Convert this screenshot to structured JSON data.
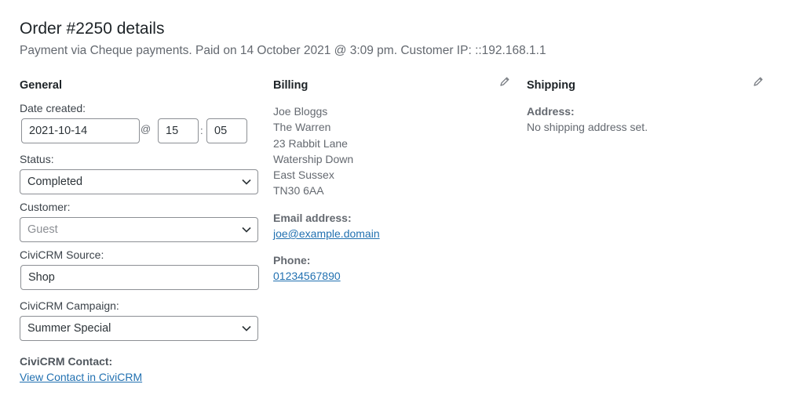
{
  "header": {
    "title": "Order #2250 details",
    "subtitle": "Payment via Cheque payments. Paid on 14 October 2021 @ 3:09 pm. Customer IP: ::192.168.1.1"
  },
  "general": {
    "heading": "General",
    "date_created_label": "Date created:",
    "date_value": "2021-10-14",
    "at_sign": "@",
    "hour_value": "15",
    "colon": ":",
    "minute_value": "05",
    "status_label": "Status:",
    "status_value": "Completed",
    "customer_label": "Customer:",
    "customer_placeholder": "Guest",
    "civicrm_source_label": "CiviCRM Source:",
    "civicrm_source_value": "Shop",
    "civicrm_campaign_label": "CiviCRM Campaign:",
    "civicrm_campaign_value": "Summer Special",
    "civicrm_contact_label": "CiviCRM Contact:",
    "civicrm_contact_link": "View Contact in CiviCRM"
  },
  "billing": {
    "heading": "Billing",
    "edit_icon": "pencil-icon",
    "address_lines": [
      "Joe Bloggs",
      "The Warren",
      "23 Rabbit Lane",
      "Watership Down",
      "East Sussex",
      "TN30 6AA"
    ],
    "email_label": "Email address:",
    "email_value": "joe@example.domain",
    "phone_label": "Phone:",
    "phone_value": "01234567890"
  },
  "shipping": {
    "heading": "Shipping",
    "edit_icon": "pencil-icon",
    "address_label": "Address:",
    "address_note": "No shipping address set."
  },
  "colors": {
    "link": "#2271b1",
    "border": "#8c8f94",
    "muted_text": "#646970"
  }
}
